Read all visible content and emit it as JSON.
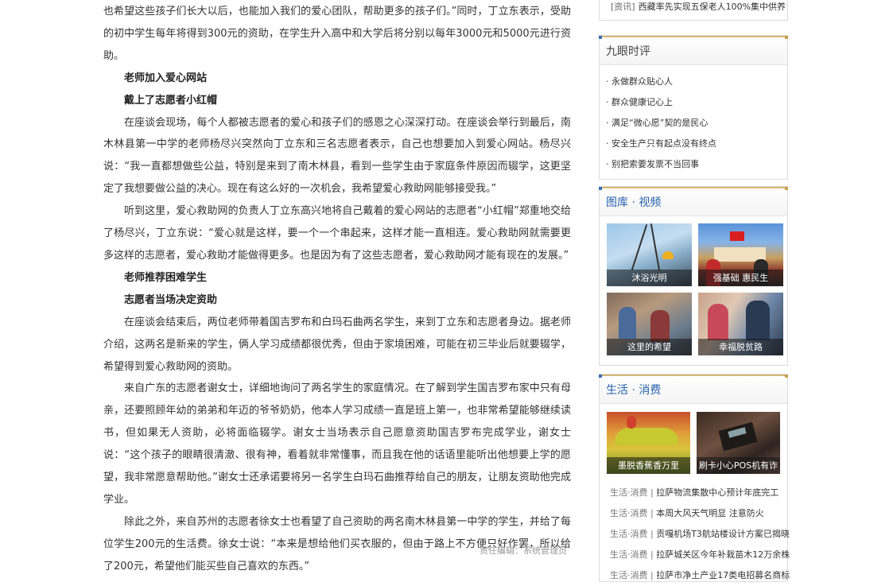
{
  "article": {
    "paragraphs": [
      {
        "type": "first",
        "text": "也希望这些孩子们长大以后，也能加入我们的爱心团队，帮助更多的孩子们。”同时，丁立东表示，受助的初中学生每年将得到300元的资助，在学生升入高中和大学后将分别以每年3000元和5000元进行资助。"
      },
      {
        "type": "sub",
        "text": "老师加入爱心网站"
      },
      {
        "type": "sub",
        "text": "戴上了志愿者小红帽"
      },
      {
        "type": "normal",
        "text": "在座谈会现场，每个人都被志愿者的爱心和孩子们的感恩之心深深打动。在座谈会举行到最后，南木林县第一中学的老师杨尽兴突然向丁立东和三名志愿者表示，自己也想要加入到爱心网站。杨尽兴说：“我一直都想做些公益，特别是来到了南木林县，看到一些学生由于家庭条件原因而辍学，这更坚定了我想要做公益的决心。现在有这么好的一次机会，我希望爱心救助网能够接受我。”"
      },
      {
        "type": "normal",
        "text": "听到这里，爱心救助网的负责人丁立东高兴地将自己戴着的爱心网站的志愿者“小红帽”郑重地交给了杨尽兴，丁立东说：“爱心就是这样，要一个一个串起来，这样才能一直相连。爱心救助网就需要更多这样的志愿者，爱心救助才能做得更多。也是因为有了这些志愿者，爱心救助网才能有现在的发展。”"
      },
      {
        "type": "sub",
        "text": "老师推荐困难学生"
      },
      {
        "type": "sub",
        "text": "志愿者当场决定资助"
      },
      {
        "type": "normal",
        "text": "在座谈会结束后，两位老师带着国吉罗布和白玛石曲两名学生，来到丁立东和志愿者身边。据老师介绍，这两名是新来的学生，俩人学习成绩都很优秀，但由于家境困难，可能在初三毕业后就要辍学，希望得到爱心救助网的资助。"
      },
      {
        "type": "normal",
        "text": "来自广东的志愿者谢女士，详细地询问了两名学生的家庭情况。在了解到学生国吉罗布家中只有母亲，还要照顾年幼的弟弟和年迈的爷爷奶奶，他本人学习成绩一直是班上第一，也非常希望能够继续读书，但如果无人资助，必将面临辍学。谢女士当场表示自己愿意资助国吉罗布完成学业，谢女士说：“这个孩子的眼睛很清澈、很有神，看着就非常懂事，而且我在他的话语里能听出他想要上学的愿望，我非常愿意帮助他。”谢女士还承诺要将另一名学生白玛石曲推荐给自己的朋友，让朋友资助他完成学业。"
      },
      {
        "type": "normal",
        "text": "除此之外，来自苏州的志愿者徐女士也看望了自己资助的两名南木林县第一中学的学生，并给了每位学生200元的生活费。徐女士说：“本来是想给他们买衣服的，但由于路上不方便只好作罢，所以给了200元，希望他们能买些自己喜欢的东西。”"
      }
    ],
    "editor": "责任编辑：系统管理员"
  },
  "sidebar": {
    "top_news": {
      "tag": "[资讯]",
      "text": "西藏率先实现五保老人100%集中供养"
    },
    "commentary": {
      "title": "九眼时评",
      "items": [
        "· 永做群众贴心人",
        "· 群众健康记心上",
        "· 满足“微心愿”契的是民心",
        "· 安全生产只有起点没有终点",
        "· 别把索要发票不当回事"
      ]
    },
    "gallery": {
      "title": "图库 · 视频",
      "pictures": [
        {
          "caption": "沐浴光明",
          "icon": "power-line-worker-photo"
        },
        {
          "caption": "强基础 惠民生",
          "icon": "flag-gate-crowd-photo"
        },
        {
          "caption": "这里的希望",
          "icon": "classroom-children-photo"
        },
        {
          "caption": "幸福脱贫路",
          "icon": "family-visit-photo"
        }
      ]
    },
    "life": {
      "title": "生活 · 消费",
      "pictures": [
        {
          "caption": "墨脱香蕉香万里",
          "icon": "banana-photo"
        },
        {
          "caption": "刷卡小心POS机有诈",
          "icon": "pos-machine-photo"
        }
      ],
      "items": [
        {
          "cat": "生活·消费 |",
          "text": "拉萨物流集散中心预计年底完工"
        },
        {
          "cat": "生活·消费 |",
          "text": "本周大风天气明显 注意防火"
        },
        {
          "cat": "生活·消费 |",
          "text": "贡嘎机场T3航站楼设计方案已揭晓"
        },
        {
          "cat": "生活·消费 |",
          "text": "拉萨城关区今年补栽苗木12万余株"
        },
        {
          "cat": "生活·消费 |",
          "text": "拉萨市净土产业17类电招募名商标"
        }
      ]
    }
  }
}
